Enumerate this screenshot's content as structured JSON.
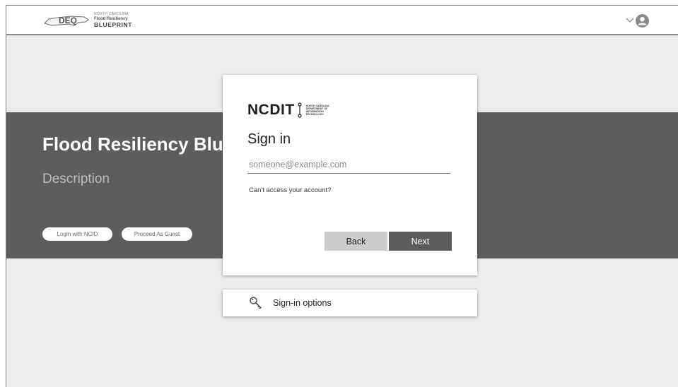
{
  "header": {
    "logo_abbr": "DEQ",
    "logo_line1": "NORTH CAROLINA",
    "logo_line2": "Flood Resiliency",
    "logo_line3": "BLUEPRINT",
    "account_icon": "user-avatar-icon",
    "dropdown_icon": "chevron-down-icon"
  },
  "hero": {
    "title": "Flood Resiliency Blu",
    "description": "Description",
    "login_button": "Login with NCID",
    "guest_button": "Proceed As Guest"
  },
  "signin": {
    "brand": "NCDIT",
    "brand_small": [
      "NORTH CAROLINA",
      "DEPARTMENT OF",
      "INFORMATION",
      "TECHNOLOGY"
    ],
    "title": "Sign in",
    "email_placeholder": "someone@example.com",
    "email_value": "",
    "cant_access": "Can't access your account?",
    "back_label": "Back",
    "next_label": "Next"
  },
  "options": {
    "label": "Sign-in options",
    "icon": "key-icon"
  },
  "colors": {
    "hero_bg": "#5c5d5f",
    "page_bg": "#ececec",
    "next_bg": "#5c5d5f",
    "back_bg": "#cccccc"
  }
}
